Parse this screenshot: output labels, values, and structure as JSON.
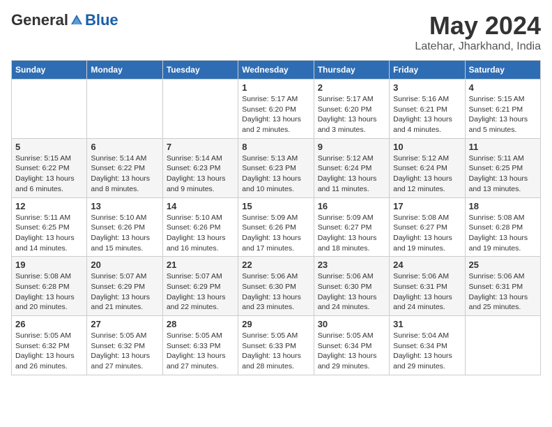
{
  "header": {
    "logo_general": "General",
    "logo_blue": "Blue",
    "month_year": "May 2024",
    "location": "Latehar, Jharkhand, India"
  },
  "weekdays": [
    "Sunday",
    "Monday",
    "Tuesday",
    "Wednesday",
    "Thursday",
    "Friday",
    "Saturday"
  ],
  "weeks": [
    [
      {
        "day": "",
        "info": ""
      },
      {
        "day": "",
        "info": ""
      },
      {
        "day": "",
        "info": ""
      },
      {
        "day": "1",
        "info": "Sunrise: 5:17 AM\nSunset: 6:20 PM\nDaylight: 13 hours\nand 2 minutes."
      },
      {
        "day": "2",
        "info": "Sunrise: 5:17 AM\nSunset: 6:20 PM\nDaylight: 13 hours\nand 3 minutes."
      },
      {
        "day": "3",
        "info": "Sunrise: 5:16 AM\nSunset: 6:21 PM\nDaylight: 13 hours\nand 4 minutes."
      },
      {
        "day": "4",
        "info": "Sunrise: 5:15 AM\nSunset: 6:21 PM\nDaylight: 13 hours\nand 5 minutes."
      }
    ],
    [
      {
        "day": "5",
        "info": "Sunrise: 5:15 AM\nSunset: 6:22 PM\nDaylight: 13 hours\nand 6 minutes."
      },
      {
        "day": "6",
        "info": "Sunrise: 5:14 AM\nSunset: 6:22 PM\nDaylight: 13 hours\nand 8 minutes."
      },
      {
        "day": "7",
        "info": "Sunrise: 5:14 AM\nSunset: 6:23 PM\nDaylight: 13 hours\nand 9 minutes."
      },
      {
        "day": "8",
        "info": "Sunrise: 5:13 AM\nSunset: 6:23 PM\nDaylight: 13 hours\nand 10 minutes."
      },
      {
        "day": "9",
        "info": "Sunrise: 5:12 AM\nSunset: 6:24 PM\nDaylight: 13 hours\nand 11 minutes."
      },
      {
        "day": "10",
        "info": "Sunrise: 5:12 AM\nSunset: 6:24 PM\nDaylight: 13 hours\nand 12 minutes."
      },
      {
        "day": "11",
        "info": "Sunrise: 5:11 AM\nSunset: 6:25 PM\nDaylight: 13 hours\nand 13 minutes."
      }
    ],
    [
      {
        "day": "12",
        "info": "Sunrise: 5:11 AM\nSunset: 6:25 PM\nDaylight: 13 hours\nand 14 minutes."
      },
      {
        "day": "13",
        "info": "Sunrise: 5:10 AM\nSunset: 6:26 PM\nDaylight: 13 hours\nand 15 minutes."
      },
      {
        "day": "14",
        "info": "Sunrise: 5:10 AM\nSunset: 6:26 PM\nDaylight: 13 hours\nand 16 minutes."
      },
      {
        "day": "15",
        "info": "Sunrise: 5:09 AM\nSunset: 6:26 PM\nDaylight: 13 hours\nand 17 minutes."
      },
      {
        "day": "16",
        "info": "Sunrise: 5:09 AM\nSunset: 6:27 PM\nDaylight: 13 hours\nand 18 minutes."
      },
      {
        "day": "17",
        "info": "Sunrise: 5:08 AM\nSunset: 6:27 PM\nDaylight: 13 hours\nand 19 minutes."
      },
      {
        "day": "18",
        "info": "Sunrise: 5:08 AM\nSunset: 6:28 PM\nDaylight: 13 hours\nand 19 minutes."
      }
    ],
    [
      {
        "day": "19",
        "info": "Sunrise: 5:08 AM\nSunset: 6:28 PM\nDaylight: 13 hours\nand 20 minutes."
      },
      {
        "day": "20",
        "info": "Sunrise: 5:07 AM\nSunset: 6:29 PM\nDaylight: 13 hours\nand 21 minutes."
      },
      {
        "day": "21",
        "info": "Sunrise: 5:07 AM\nSunset: 6:29 PM\nDaylight: 13 hours\nand 22 minutes."
      },
      {
        "day": "22",
        "info": "Sunrise: 5:06 AM\nSunset: 6:30 PM\nDaylight: 13 hours\nand 23 minutes."
      },
      {
        "day": "23",
        "info": "Sunrise: 5:06 AM\nSunset: 6:30 PM\nDaylight: 13 hours\nand 24 minutes."
      },
      {
        "day": "24",
        "info": "Sunrise: 5:06 AM\nSunset: 6:31 PM\nDaylight: 13 hours\nand 24 minutes."
      },
      {
        "day": "25",
        "info": "Sunrise: 5:06 AM\nSunset: 6:31 PM\nDaylight: 13 hours\nand 25 minutes."
      }
    ],
    [
      {
        "day": "26",
        "info": "Sunrise: 5:05 AM\nSunset: 6:32 PM\nDaylight: 13 hours\nand 26 minutes."
      },
      {
        "day": "27",
        "info": "Sunrise: 5:05 AM\nSunset: 6:32 PM\nDaylight: 13 hours\nand 27 minutes."
      },
      {
        "day": "28",
        "info": "Sunrise: 5:05 AM\nSunset: 6:33 PM\nDaylight: 13 hours\nand 27 minutes."
      },
      {
        "day": "29",
        "info": "Sunrise: 5:05 AM\nSunset: 6:33 PM\nDaylight: 13 hours\nand 28 minutes."
      },
      {
        "day": "30",
        "info": "Sunrise: 5:05 AM\nSunset: 6:34 PM\nDaylight: 13 hours\nand 29 minutes."
      },
      {
        "day": "31",
        "info": "Sunrise: 5:04 AM\nSunset: 6:34 PM\nDaylight: 13 hours\nand 29 minutes."
      },
      {
        "day": "",
        "info": ""
      }
    ]
  ]
}
